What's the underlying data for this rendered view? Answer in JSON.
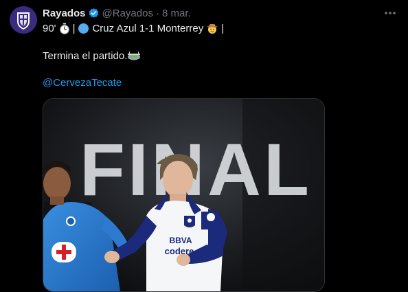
{
  "tweet": {
    "author_name": "Rayados",
    "handle": "@Rayados",
    "separator": "·",
    "date": "8 mar.",
    "line1": {
      "minute": "90'",
      "sep1": "|",
      "match": "Cruz Azul 1-1 Monterrey",
      "end_bar": "|"
    },
    "line2_text": "Termina el partido.",
    "mention": "@CervezaTecate"
  },
  "media": {
    "headline": "FINAL",
    "jersey_sponsor_1": "BBVA",
    "jersey_sponsor_2": "codere"
  },
  "colors": {
    "background": "#000000",
    "text": "#e7e9ea",
    "muted": "#71767b",
    "link": "#1d9bf0",
    "verified": "#1d9bf0"
  },
  "icons": [
    "verified-badge-icon",
    "more-options-icon",
    "stopwatch-icon",
    "blue-circle-icon",
    "cowboy-emoji-icon",
    "stadium-emoji-icon"
  ]
}
